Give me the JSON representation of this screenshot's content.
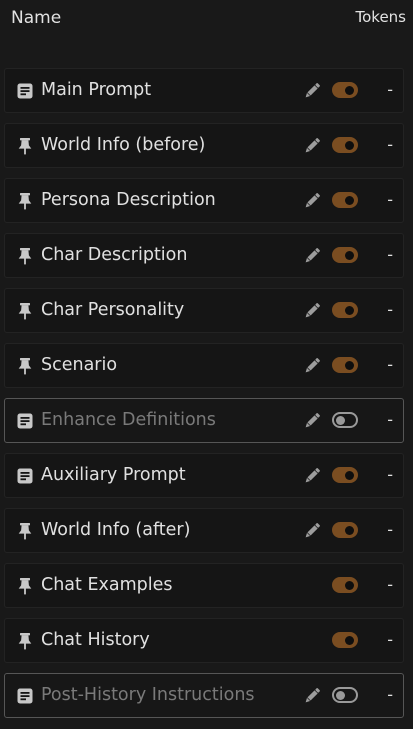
{
  "header": {
    "name_label": "Name",
    "tokens_label": "Tokens"
  },
  "colors": {
    "toggle_on": "#7a4d21",
    "toggle_off": "#9a9a9a",
    "background": "#191919"
  },
  "prompts": [
    {
      "label": "Main Prompt",
      "icon": "document-icon",
      "enabled": true,
      "editable": true,
      "tokens": "-"
    },
    {
      "label": "World Info (before)",
      "icon": "pin-icon",
      "enabled": true,
      "editable": true,
      "tokens": "-"
    },
    {
      "label": "Persona Description",
      "icon": "pin-icon",
      "enabled": true,
      "editable": true,
      "tokens": "-"
    },
    {
      "label": "Char Description",
      "icon": "pin-icon",
      "enabled": true,
      "editable": true,
      "tokens": "-"
    },
    {
      "label": "Char Personality",
      "icon": "pin-icon",
      "enabled": true,
      "editable": true,
      "tokens": "-"
    },
    {
      "label": "Scenario",
      "icon": "pin-icon",
      "enabled": true,
      "editable": true,
      "tokens": "-"
    },
    {
      "label": "Enhance Definitions",
      "icon": "document-icon",
      "enabled": false,
      "editable": true,
      "tokens": "-"
    },
    {
      "label": "Auxiliary Prompt",
      "icon": "document-icon",
      "enabled": true,
      "editable": true,
      "tokens": "-"
    },
    {
      "label": "World Info (after)",
      "icon": "pin-icon",
      "enabled": true,
      "editable": true,
      "tokens": "-"
    },
    {
      "label": "Chat Examples",
      "icon": "pin-icon",
      "enabled": true,
      "editable": false,
      "tokens": "-"
    },
    {
      "label": "Chat History",
      "icon": "pin-icon",
      "enabled": true,
      "editable": false,
      "tokens": "-"
    },
    {
      "label": "Post-History Instructions",
      "icon": "document-icon",
      "enabled": false,
      "editable": true,
      "tokens": "-"
    }
  ]
}
